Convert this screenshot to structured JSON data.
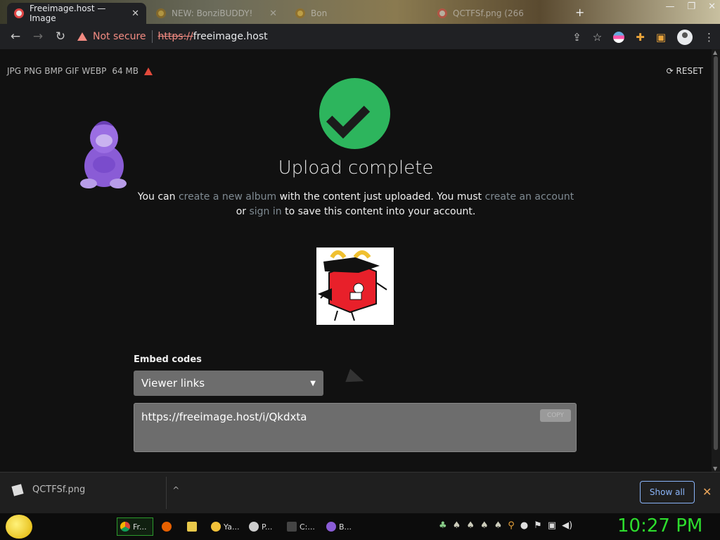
{
  "tabs": [
    {
      "title": "Freeimage.host — Image",
      "active": true
    },
    {
      "title": "NEW: BonziBUDDY!",
      "active": false
    },
    {
      "title": "Bon",
      "active": false
    },
    {
      "title": "QCTFSf.png (266",
      "active": false
    }
  ],
  "toolbar": {
    "security_label": "Not secure",
    "url_scheme": "https://",
    "url_host": "freeimage.host"
  },
  "page": {
    "formats": "JPG PNG BMP GIF WEBP",
    "max_size": "64 MB",
    "reset_label": "RESET",
    "title": "Upload complete",
    "msg_1": "You can",
    "link_album": "create a new album",
    "msg_2": "with the content just uploaded. You must",
    "link_account": "create an account",
    "msg_3": "or",
    "link_signin": "sign in",
    "msg_4": "to save this content into your account.",
    "embed_label": "Embed codes",
    "embed_select": "Viewer links",
    "embed_code": "https://freeimage.host/i/Qkdxta",
    "copy_label": "COPY"
  },
  "downloads": {
    "file_name": "QCTFSf.png",
    "show_all": "Show all"
  },
  "taskbar": {
    "items": [
      "Fr...",
      "",
      "",
      "Ya...",
      "P...",
      "C:...",
      "B..."
    ],
    "clock": "10:27 PM"
  },
  "colors": {
    "success": "#2db55d",
    "link": "#7f8a92",
    "clock": "#2ddc2d",
    "warning": "#f28b82"
  }
}
